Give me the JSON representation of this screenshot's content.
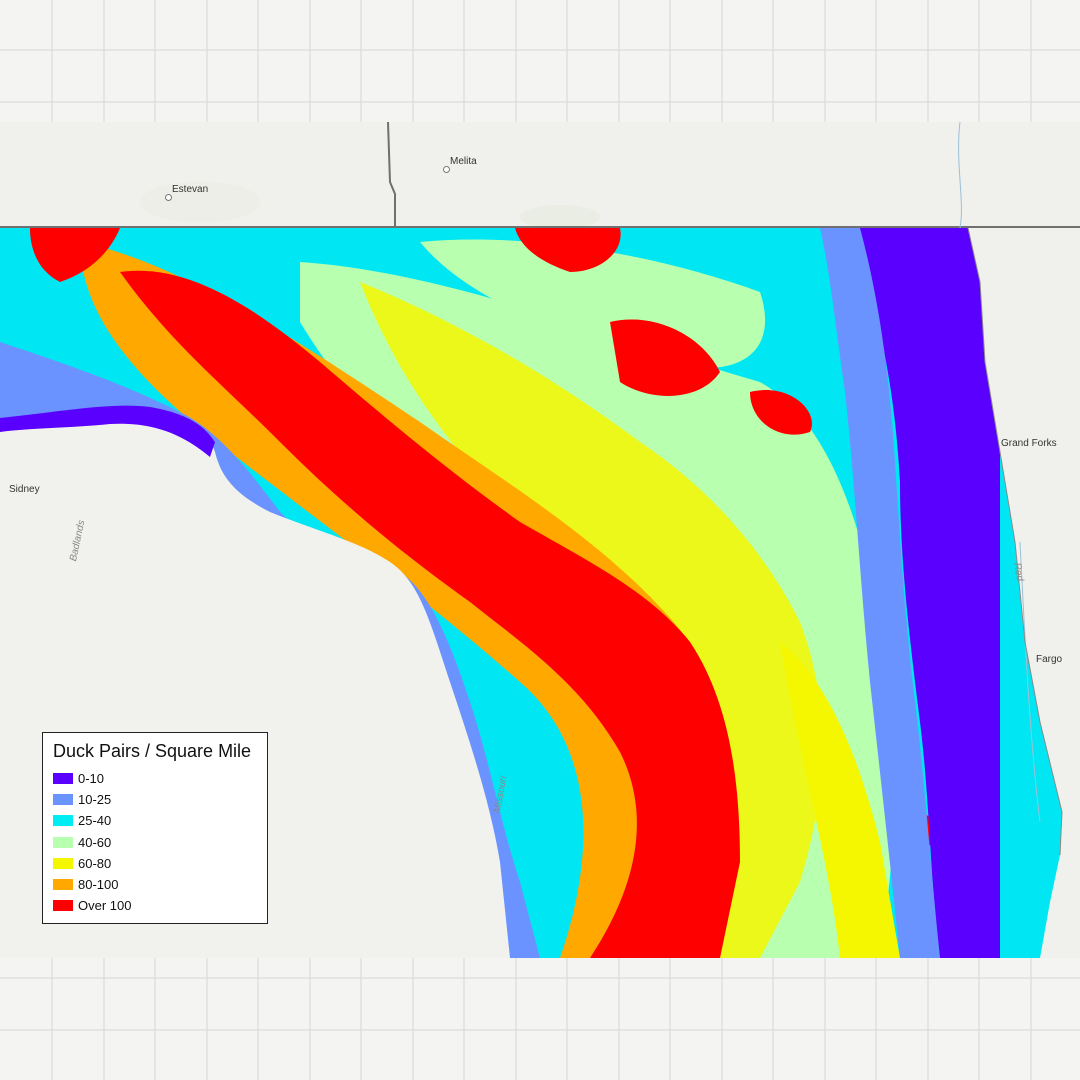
{
  "map": {
    "places": [
      {
        "name": "Estevan"
      },
      {
        "name": "Melita"
      },
      {
        "name": "Sidney"
      },
      {
        "name": "Grand Forks"
      },
      {
        "name": "Fargo"
      }
    ],
    "features": [
      {
        "name": "Badlands"
      },
      {
        "name": "Missouri"
      },
      {
        "name": "Red"
      }
    ]
  },
  "legend": {
    "title": "Duck Pairs / Square Mile",
    "items": [
      {
        "label": "0-10",
        "color": "#5a00ff"
      },
      {
        "label": "10-25",
        "color": "#6b93ff"
      },
      {
        "label": "25-40",
        "color": "#00ecf5"
      },
      {
        "label": "40-60",
        "color": "#b8ffb0"
      },
      {
        "label": "60-80",
        "color": "#f4f700"
      },
      {
        "label": "80-100",
        "color": "#ffa800"
      },
      {
        "label": "Over 100",
        "color": "#ff0000"
      }
    ]
  }
}
